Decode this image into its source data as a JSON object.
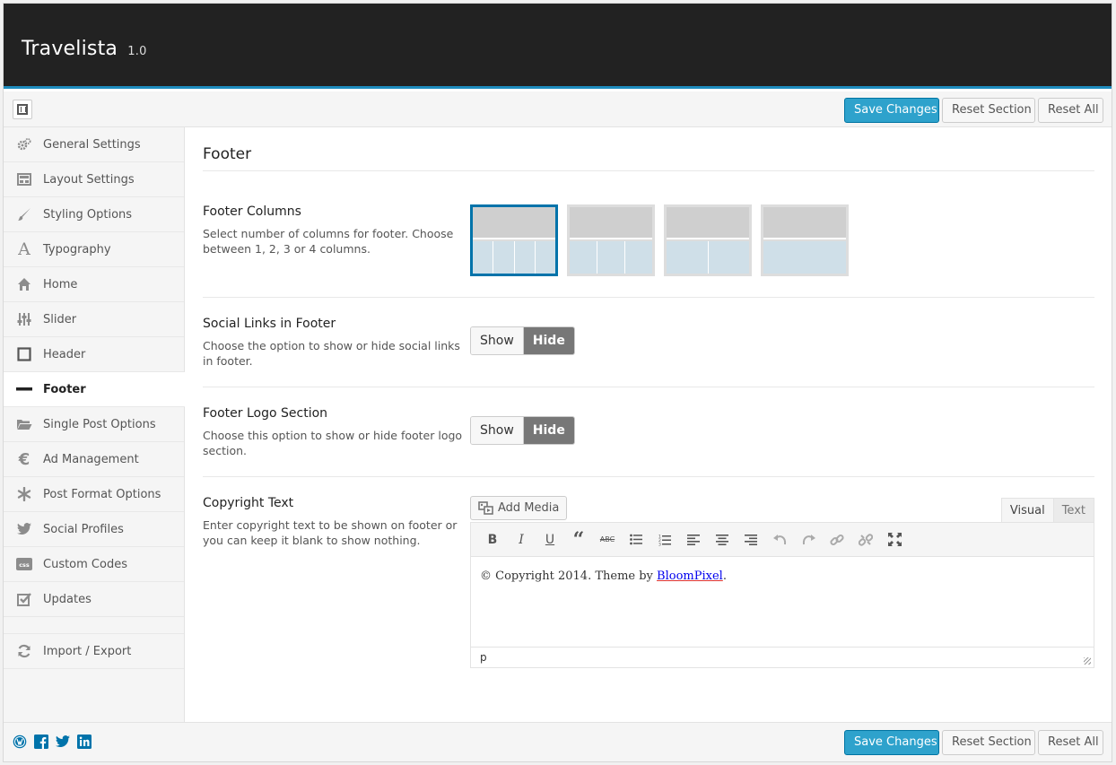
{
  "app": {
    "title": "Travelista",
    "version": "1.0"
  },
  "buttons": {
    "save": "Save Changes",
    "reset_section": "Reset Section",
    "reset_all": "Reset All"
  },
  "sidebar": {
    "items": [
      {
        "label": "General Settings",
        "icon": "gears-icon"
      },
      {
        "label": "Layout Settings",
        "icon": "layout-icon"
      },
      {
        "label": "Styling Options",
        "icon": "brush-icon"
      },
      {
        "label": "Typography",
        "icon": "typography-icon"
      },
      {
        "label": "Home",
        "icon": "home-icon"
      },
      {
        "label": "Slider",
        "icon": "sliders-icon"
      },
      {
        "label": "Header",
        "icon": "square-icon"
      },
      {
        "label": "Footer",
        "icon": "minus-icon",
        "active": true
      },
      {
        "label": "Single Post Options",
        "icon": "folder-icon"
      },
      {
        "label": "Ad Management",
        "icon": "euro-icon"
      },
      {
        "label": "Post Format Options",
        "icon": "asterisk-icon"
      },
      {
        "label": "Social Profiles",
        "icon": "twitter-icon"
      },
      {
        "label": "Custom Codes",
        "icon": "css-icon"
      },
      {
        "label": "Updates",
        "icon": "checkbox-icon"
      }
    ],
    "extra": {
      "label": "Import / Export",
      "icon": "refresh-icon"
    }
  },
  "main": {
    "section_title": "Footer",
    "footer_columns": {
      "title": "Footer Columns",
      "desc": "Select number of columns for footer. Choose between 1, 2, 3 or 4 columns.",
      "selected": 4
    },
    "social_links": {
      "title": "Social Links in Footer",
      "desc": "Choose the option to show or hide social links in footer.",
      "show": "Show",
      "hide": "Hide",
      "value": "Hide"
    },
    "footer_logo": {
      "title": "Footer Logo Section",
      "desc": "Choose this option to show or hide footer logo section.",
      "show": "Show",
      "hide": "Hide",
      "value": "Hide"
    },
    "copyright": {
      "title": "Copyright Text",
      "desc": "Enter copyright text to be shown on footer or you can keep it blank to show nothing.",
      "add_media": "Add Media",
      "tab_visual": "Visual",
      "tab_text": "Text",
      "content_prefix": "© Copyright 2014. Theme by ",
      "content_link": "BloomPixel",
      "content_suffix": ".",
      "status_path": "p"
    }
  },
  "colors": {
    "header_bg": "#222222",
    "accent": "#2ea2cc",
    "accent_border": "#1e8cbe"
  }
}
